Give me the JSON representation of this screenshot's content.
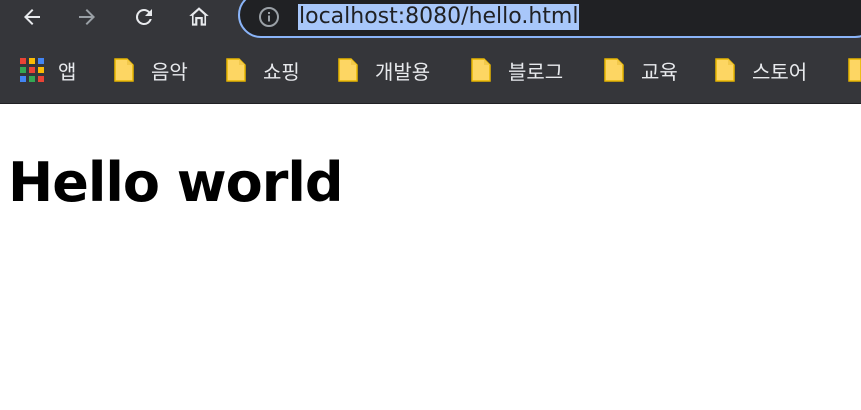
{
  "browser": {
    "address_bar": {
      "url": "localhost:8080/hello.html"
    },
    "bookmarks": [
      {
        "label": "앱"
      },
      {
        "label": "음악"
      },
      {
        "label": "쇼핑"
      },
      {
        "label": "개발용"
      },
      {
        "label": "블로그"
      },
      {
        "label": "교육"
      },
      {
        "label": "스토어"
      }
    ]
  },
  "page": {
    "heading": "Hello world"
  },
  "colors": {
    "toolbar_bg": "#35363a",
    "omnibox_bg": "#202124",
    "focus_ring": "#8ab4f8",
    "url_highlight": "#a8c7fa",
    "folder_yellow": "#fdd663"
  }
}
